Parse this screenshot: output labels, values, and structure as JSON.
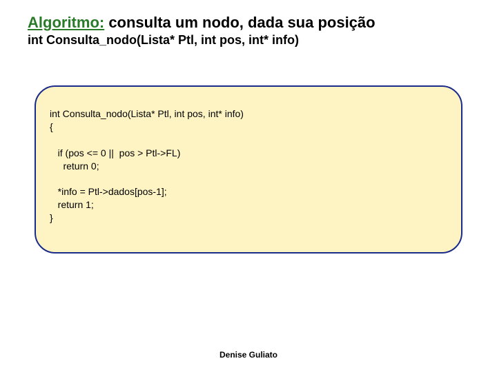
{
  "title": {
    "word": "Algoritmo:",
    "rest": " consulta um nodo, dada sua posição"
  },
  "signature": "int Consulta_nodo(Lista* Ptl, int pos, int* info)",
  "code": "int Consulta_nodo(Lista* Ptl, int pos, int* info)\n{\n\n   if (pos <= 0 ||  pos > Ptl->FL)\n     return 0;\n\n   *info = Ptl->dados[pos-1];\n   return 1;\n}",
  "footer": "Denise Guliato"
}
